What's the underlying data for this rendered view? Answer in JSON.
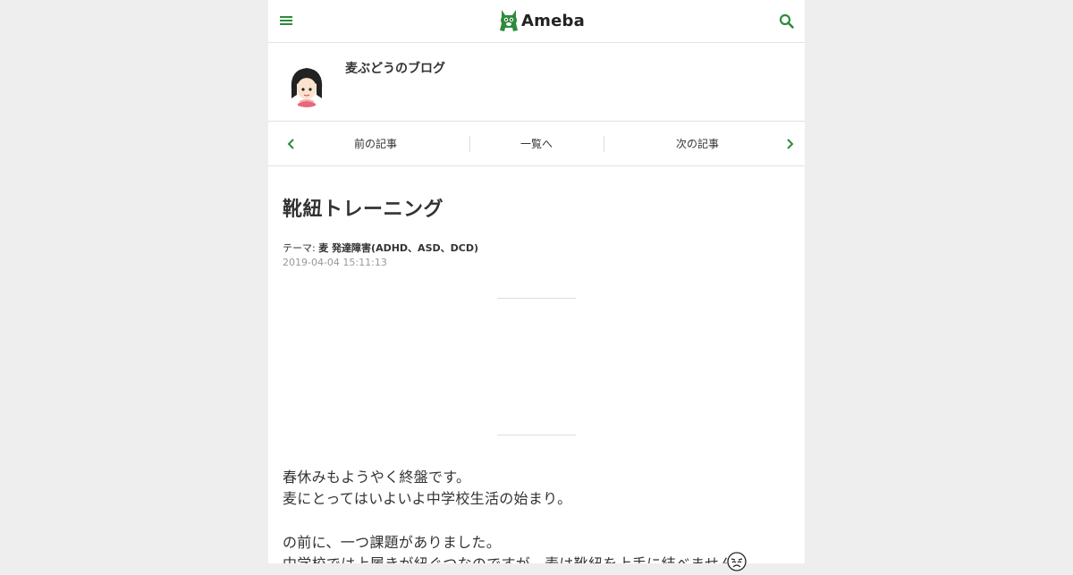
{
  "header": {
    "logo_text": "Ameba",
    "menu_icon": "hamburger-menu-icon",
    "search_icon": "search-icon",
    "accent_color": "#2d8c3c"
  },
  "blog": {
    "title": "麦ぶどうのブログ",
    "avatar_icon": "girl-avatar"
  },
  "article_nav": {
    "prev_label": "前の記事",
    "list_label": "一覧へ",
    "next_label": "次の記事"
  },
  "entry": {
    "title": "靴紐トレーニング",
    "theme_label": "テーマ:",
    "theme_value": "麦 発達障害(ADHD、ASD、DCD)",
    "date": "2019-04-04 15:11:13",
    "paragraphs": [
      "春休みもようやく終盤です。",
      "麦にとってはいよいよ中学校生活の始まり。",
      "の前に、一つ課題がありました。",
      "中学校では上履きが紐ぐつなのですが、麦は靴紐を上手に結べません"
    ],
    "trailing_emoji": "crying-face-icon"
  }
}
